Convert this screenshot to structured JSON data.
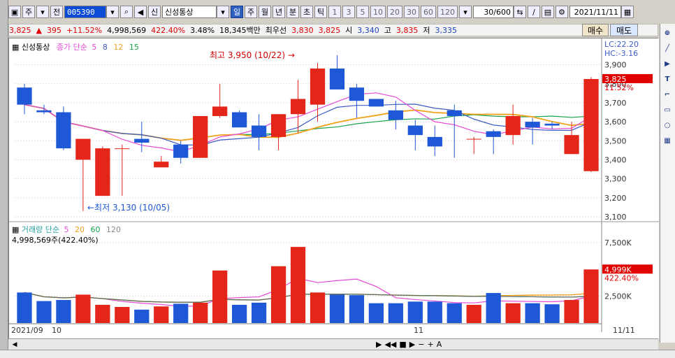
{
  "toolbar": {
    "period_options": [
      "일",
      "주",
      "월",
      "년",
      "분",
      "초",
      "틱"
    ],
    "selected_period": "일",
    "small_period": "주",
    "code_label": "전",
    "code_value": "005390",
    "stock_name": "신성통상",
    "minutes": [
      "1",
      "3",
      "5",
      "10",
      "20",
      "30",
      "60",
      "120"
    ],
    "count": "30/600",
    "date": "2021/11/11"
  },
  "quote": {
    "price": "3,825",
    "change_arrow": "▲",
    "change": "395",
    "change_pct": "+11.52%",
    "volume": "4,998,569",
    "volume_pct": "422.40%",
    "turnover": "3.48%",
    "amount": "18,345백만",
    "best_ask_label": "최우선",
    "best_ask": "3,830",
    "best_bid": "3,825",
    "open_label": "시",
    "open": "3,340",
    "high_label": "고",
    "high": "3,835",
    "low_label": "저",
    "low": "3,335",
    "buy_label": "매수",
    "sell_label": "매도"
  },
  "chart": {
    "price_label": "신성통상",
    "ma_label": "종가 단순",
    "ma_periods": [
      "5",
      "8",
      "12",
      "15"
    ],
    "volume_label": "거래량 단순",
    "volume_ma_periods": [
      "5",
      "20",
      "60",
      "120"
    ],
    "volume_current": "4,998,569주(422.40%)",
    "right_price": "3,825",
    "right_pct": "11.52%",
    "right_lc": "LC:22.20",
    "right_hc": "HC:-3.16",
    "right_vol": "4,999K",
    "right_vol_pct": "422.40%",
    "max_annotation": "최고 3,950 (10/22) →",
    "min_annotation": "←최저 3,130 (10/05)",
    "x_labels": [
      "2021/09",
      "10",
      "11",
      "11/11"
    ],
    "price_ticks": [
      "3,900",
      "3,800",
      "3,700",
      "3,600",
      "3,500",
      "3,400",
      "3,300",
      "3,200",
      "3,100"
    ],
    "volume_ticks": [
      "7,500K",
      "2,500K"
    ],
    "colors": {
      "up": "#e32619",
      "down": "#1f58d6",
      "ma5": "#e64ad8",
      "ma8": "#3c5bc3",
      "ma12": "#f1a11a",
      "ma15": "#17a34a"
    }
  },
  "chart_data": {
    "type": "candlestick",
    "x": [
      "09/29",
      "09/30",
      "10/01",
      "10/05",
      "10/06",
      "10/07",
      "10/08",
      "10/12",
      "10/13",
      "10/14",
      "10/15",
      "10/18",
      "10/19",
      "10/20",
      "10/21",
      "10/22",
      "10/25",
      "10/26",
      "10/27",
      "10/28",
      "10/29",
      "11/01",
      "11/02",
      "11/03",
      "11/04",
      "11/05",
      "11/08",
      "11/09",
      "11/10",
      "11/11"
    ],
    "open": [
      3780,
      3660,
      3650,
      3400,
      3210,
      3460,
      3510,
      3360,
      3480,
      3410,
      3630,
      3650,
      3580,
      3520,
      3640,
      3690,
      3880,
      3780,
      3720,
      3660,
      3580,
      3520,
      3660,
      3510,
      3550,
      3530,
      3600,
      3590,
      3430,
      3340
    ],
    "high": [
      3800,
      3690,
      3680,
      3470,
      3470,
      3480,
      3600,
      3420,
      3500,
      3550,
      3800,
      3660,
      3640,
      3560,
      3820,
      3910,
      3950,
      3800,
      3720,
      3710,
      3610,
      3580,
      3690,
      3520,
      3560,
      3690,
      3620,
      3600,
      3600,
      3835
    ],
    "low": [
      3640,
      3640,
      3450,
      3130,
      3210,
      3210,
      3440,
      3370,
      3380,
      3410,
      3620,
      3590,
      3450,
      3450,
      3540,
      3600,
      3860,
      3620,
      3700,
      3560,
      3450,
      3420,
      3410,
      3430,
      3430,
      3480,
      3480,
      3560,
      3430,
      3335
    ],
    "close": [
      3690,
      3650,
      3460,
      3510,
      3460,
      3460,
      3490,
      3390,
      3410,
      3630,
      3680,
      3570,
      3520,
      3640,
      3720,
      3880,
      3770,
      3710,
      3680,
      3610,
      3530,
      3470,
      3630,
      3510,
      3520,
      3630,
      3570,
      3580,
      3530,
      3825
    ],
    "volume": [
      2850,
      2050,
      2150,
      2650,
      1700,
      1500,
      1250,
      1550,
      1800,
      1900,
      4900,
      1700,
      1900,
      5300,
      7100,
      2850,
      2650,
      2600,
      1850,
      1850,
      2000,
      2000,
      1850,
      1700,
      2800,
      1850,
      1850,
      1750,
      2150,
      5000
    ]
  }
}
